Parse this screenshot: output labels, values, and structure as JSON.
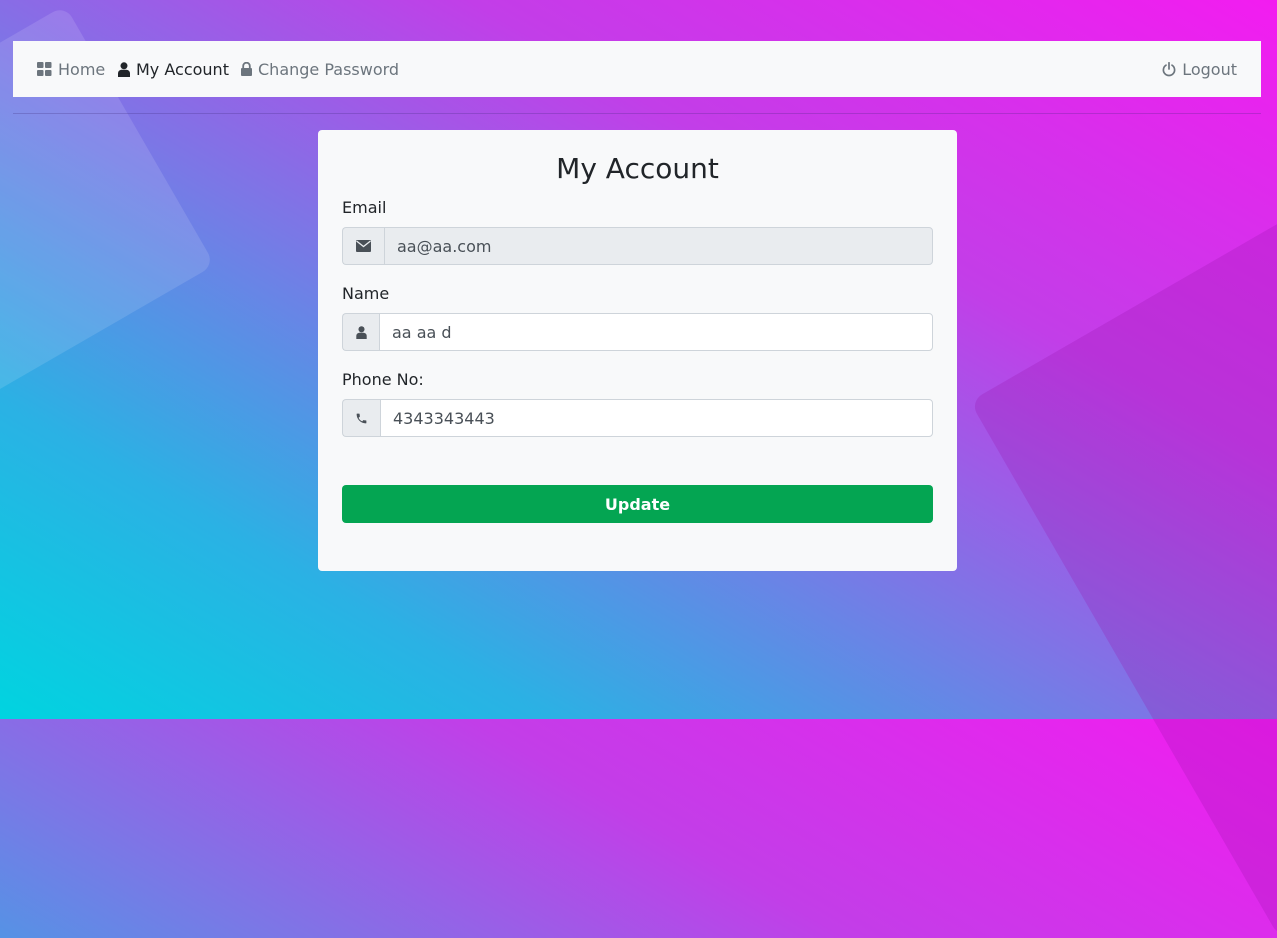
{
  "nav": {
    "home": {
      "label": "Home",
      "icon": "grid-icon"
    },
    "my_account": {
      "label": "My Account",
      "icon": "user-icon"
    },
    "change_password": {
      "label": "Change Password",
      "icon": "lock-icon"
    },
    "logout": {
      "label": "Logout",
      "icon": "power-icon"
    }
  },
  "card": {
    "title": "My Account",
    "fields": [
      {
        "label": "Email",
        "value": "aa@aa.com",
        "icon": "envelope-icon",
        "readonly": true
      },
      {
        "label": "Name",
        "value": "aa aa d",
        "icon": "user-icon",
        "readonly": false
      },
      {
        "label": "Phone No:",
        "value": "4343343443",
        "icon": "phone-icon",
        "readonly": false
      }
    ],
    "submit_label": "Update"
  },
  "colors": {
    "accent_button": "#04a552",
    "navbar_bg": "#f8f9fa",
    "card_bg": "#f8f9fa",
    "gradient_start": "#00d4e0",
    "gradient_end": "#f31cf0"
  }
}
